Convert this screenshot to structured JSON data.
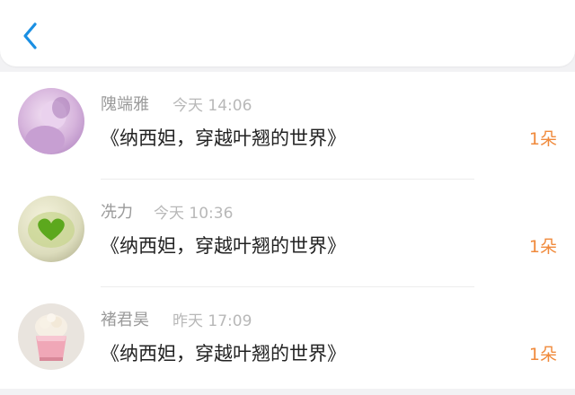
{
  "header": {
    "back_icon": "chevron-left-icon"
  },
  "colors": {
    "accent": "#1a8fe3",
    "count": "#f08a3c",
    "name": "#9a9a9a",
    "time": "#b8b8b8",
    "title": "#222222"
  },
  "items": [
    {
      "name": "隗端雅",
      "time": "今天 14:06",
      "title": "《纳西妲，穿越叶翘的世界》",
      "count": "1朵"
    },
    {
      "name": "冼力",
      "time": "今天 10:36",
      "title": "《纳西妲，穿越叶翘的世界》",
      "count": "1朵"
    },
    {
      "name": "褚君昊",
      "time": "昨天 17:09",
      "title": "《纳西妲，穿越叶翘的世界》",
      "count": "1朵"
    }
  ]
}
